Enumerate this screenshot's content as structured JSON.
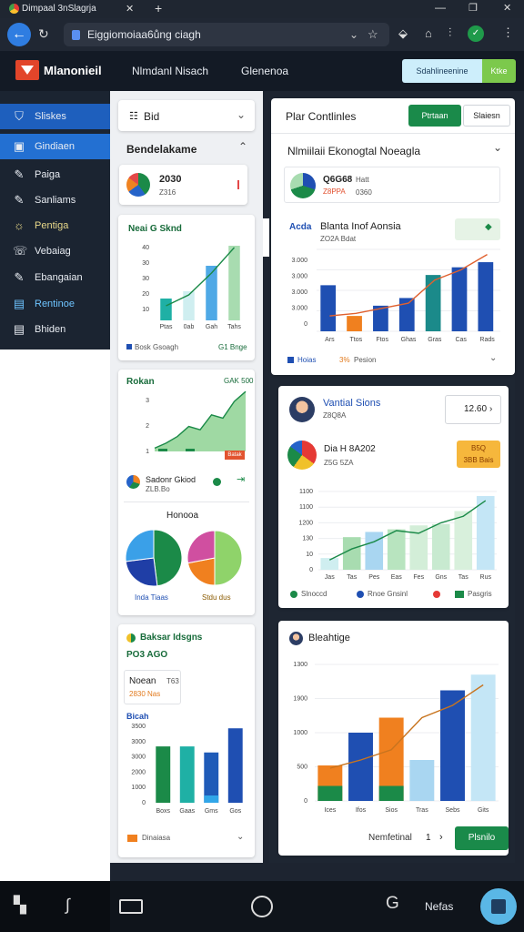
{
  "browser": {
    "tab_title": "Dimpaal 3nSlagrja",
    "new_tab": "+",
    "url": "Eiggiomoiaa6ůng ciagh",
    "window_controls": [
      "—",
      "❐",
      "✕"
    ]
  },
  "appbar": {
    "brand": "Mlanonieil",
    "nav": [
      "Nlmdanl Nisach",
      "Glenenoa"
    ],
    "search_button": "Sdahlineenine",
    "green_button": "Ktke"
  },
  "sidebar": {
    "items": [
      {
        "label": "Sliskes",
        "icon": "shield-icon"
      },
      {
        "label": "Gindiaen",
        "icon": "monitor-icon"
      },
      {
        "label": "Paiga",
        "icon": "pen-icon"
      },
      {
        "label": "Sanliams",
        "icon": "pen-icon"
      },
      {
        "label": "Pentiga",
        "icon": "bulb-icon"
      },
      {
        "label": "Vebaiag",
        "icon": "chat-icon"
      },
      {
        "label": "Ebangaian",
        "icon": "pen-icon"
      },
      {
        "label": "Rentinoe",
        "icon": "list-icon"
      },
      {
        "label": "Bhiden",
        "icon": "list-icon"
      }
    ]
  },
  "left": {
    "select_label": "Bid",
    "section_title": "Bendelakame",
    "kpi": {
      "value": "2030",
      "sub": "Z316"
    },
    "chart1": {
      "title": "Neai G Sknd",
      "y_ticks": [
        "40",
        "30",
        "30",
        "20",
        "10"
      ],
      "x_ticks": [
        "Ptas",
        "0ab",
        "Gah",
        "Tahs"
      ],
      "legend_left": "Bosk Gsoagh",
      "legend_right": "G1 Bnge"
    },
    "chart2": {
      "title": "Rokan",
      "top_right": "GAK 500",
      "badge": "Batak",
      "y_ticks": [
        "3",
        "2",
        "1"
      ]
    },
    "person": {
      "name": "Sadonr Gkiod",
      "sub": "ZLB.Bo"
    },
    "pies_title": "Honooa",
    "pies_legend_left": "Inda Tiaas",
    "pies_legend_right": "Stdu dus",
    "bar_section": {
      "title": "Baksar Idsgns",
      "value": "PO3 AGO"
    },
    "mini": {
      "title": "Noean",
      "sub": "2830 Nas",
      "right": "T63"
    },
    "chart3": {
      "title": "Bicah",
      "y_ticks": [
        "3500",
        "3000",
        "3000",
        "2000",
        "1000",
        "0"
      ],
      "x_ticks": [
        "Boxs",
        "Gaas",
        "Gms",
        "Gos"
      ],
      "legend": "Dinaiasa"
    }
  },
  "right": {
    "header": {
      "title": "Plar Contlinles",
      "btn1": "Ptrtaan",
      "btn2": "Slaiesn"
    },
    "section_title": "Nlmiilaii Ekonogtal Noeagla",
    "kpi": {
      "value": "Q6G68",
      "sub": "Z8PPA",
      "right1": "Hatt",
      "right2": "0360"
    },
    "chart1": {
      "label_left": "Acda",
      "title": "Blanta Inof Aonsia",
      "sub": "ZO2A Bdat",
      "y_ticks": [
        "3.000",
        "3.000",
        "3.000",
        "3.000",
        "0"
      ],
      "x_ticks": [
        "Ars",
        "Ttos",
        "Ftos",
        "Ghas",
        "Gras",
        "Cas",
        "Rads"
      ],
      "legend_left": "Hoias",
      "legend_right": "Pesion",
      "legend_prefix": "3%"
    },
    "block2": {
      "title": "Vantial Sions",
      "sub": "Z8Q8A",
      "select": "12.60",
      "row_title": "Dia H 8A202",
      "row_sub": "Z5G 5ZA",
      "badge_line1": "B5Q",
      "badge_line2": "3BB Bais"
    },
    "chart2": {
      "y_ticks": [
        "1100",
        "1100",
        "1200",
        "130",
        "10",
        "0"
      ],
      "x_ticks": [
        "Jas",
        "Tas",
        "Pes",
        "Eas",
        "Fes",
        "Gns",
        "Tas",
        "Rus"
      ],
      "legend": [
        "Slnoccd",
        "Rnoe Gnsinl",
        "Pasgris"
      ]
    },
    "chart3": {
      "title": "Bleahtige",
      "y_ticks": [
        "1300",
        "1900",
        "1000",
        "500",
        "0"
      ],
      "x_ticks": [
        "Ices",
        "Ifos",
        "Sios",
        "Tras",
        "Sebs",
        "Gits"
      ],
      "footer_text": "Nemfetinal",
      "footer_pager": "1",
      "footer_button": "Plsnilo"
    }
  },
  "bottombar": {
    "label": "Nefas"
  },
  "colors": {
    "green": "#1a8a4a",
    "blue": "#1f4fb2",
    "orange": "#f0801f",
    "teal": "#1fb0a5",
    "lightgreen": "#a8dcb0",
    "lightblue": "#a9d6f1"
  },
  "chart_data": [
    {
      "type": "bar",
      "id": "left-1",
      "categories": [
        "Ptas",
        "0ab",
        "Gah",
        "Tahs"
      ],
      "values": [
        12,
        16,
        30,
        41
      ],
      "line": [
        8,
        14,
        26,
        40
      ],
      "ylim": [
        0,
        40
      ],
      "y_ticks": [
        "40",
        "30",
        "30",
        "20",
        "10"
      ]
    },
    {
      "type": "area",
      "id": "left-2",
      "values": [
        0.2,
        0.5,
        0.9,
        1.5,
        1.3,
        2.2,
        2.0,
        3.0,
        3.6
      ],
      "ylim": [
        0,
        3.5
      ],
      "y_ticks": [
        "3",
        "2",
        "1"
      ]
    },
    {
      "type": "pie",
      "id": "left-pie-1",
      "values": [
        48,
        25,
        27
      ]
    },
    {
      "type": "pie",
      "id": "left-pie-2",
      "values": [
        50,
        22,
        28
      ]
    },
    {
      "type": "bar",
      "id": "left-3",
      "categories": [
        "Boxs",
        "Gaas",
        "Gms",
        "Gos"
      ],
      "values": [
        2800,
        2800,
        2500,
        3700
      ],
      "ylim": [
        0,
        3800
      ],
      "y_ticks": [
        "3500",
        "3000",
        "3000",
        "2000",
        "1000",
        "0"
      ]
    },
    {
      "type": "bar",
      "id": "right-1",
      "categories": [
        "Ars",
        "Ttos",
        "Ftos",
        "Ghas",
        "Gras",
        "Cas",
        "Rads"
      ],
      "values": [
        1.8,
        0.6,
        1.0,
        1.3,
        2.2,
        2.5,
        2.7
      ],
      "line": [
        0.6,
        0.7,
        0.9,
        1.1,
        2.0,
        2.4,
        3.0
      ],
      "ylim": [
        0,
        3.2
      ],
      "y_ticks": [
        "3.000",
        "3.000",
        "3.000",
        "3.000",
        "0"
      ]
    },
    {
      "type": "bar",
      "id": "right-2",
      "categories": [
        "Jas",
        "Tas",
        "Pes",
        "Eas",
        "Fes",
        "Gns",
        "Tas",
        "Rus"
      ],
      "values": [
        180,
        500,
        580,
        620,
        680,
        700,
        900,
        1130
      ],
      "line": [
        150,
        320,
        430,
        600,
        560,
        720,
        820,
        1060
      ],
      "ylim": [
        0,
        1200
      ],
      "y_ticks": [
        "1100",
        "1100",
        "1200",
        "130",
        "10",
        "0"
      ]
    },
    {
      "type": "bar",
      "id": "right-3",
      "categories": [
        "Ices",
        "Ifos",
        "Sios",
        "Tras",
        "Sebs",
        "Gits"
      ],
      "stack_green": [
        220,
        0,
        220,
        0,
        0,
        0
      ],
      "stack_orange": [
        300,
        0,
        800,
        0,
        0,
        0
      ],
      "values": [
        520,
        1000,
        1220,
        600,
        1620,
        1850
      ],
      "line": [
        480,
        600,
        750,
        1220,
        1400,
        1700
      ],
      "ylim": [
        0,
        2000
      ],
      "y_ticks": [
        "1300",
        "1900",
        "1000",
        "500",
        "0"
      ]
    }
  ]
}
